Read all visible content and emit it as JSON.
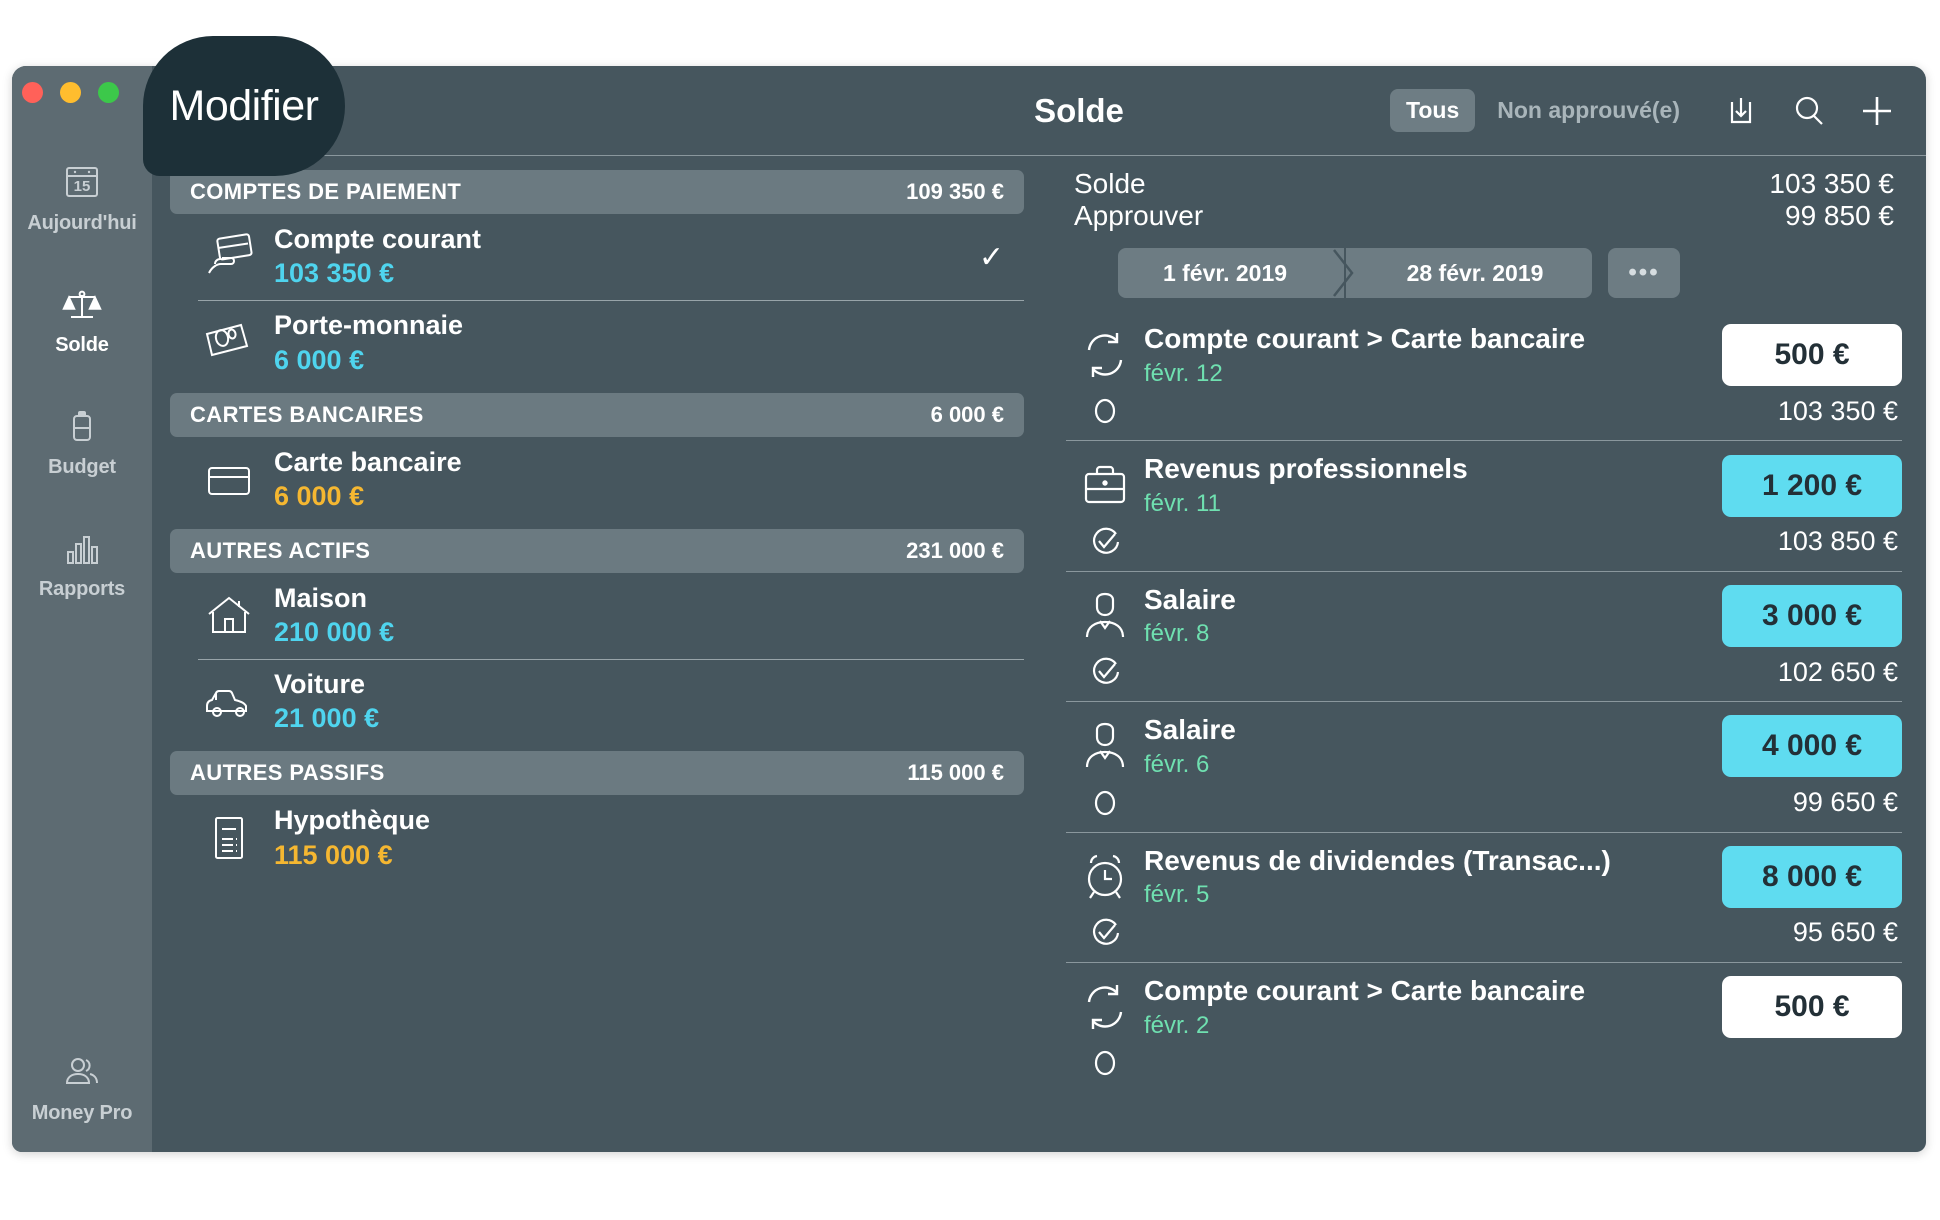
{
  "window": {
    "traffic_lights": [
      "close",
      "minimize",
      "maximize"
    ]
  },
  "overlay": {
    "tooltip_label": "Modifier"
  },
  "sidebar": {
    "items": [
      {
        "label": "Aujourd'hui",
        "icon": "calendar-15-icon",
        "active": false
      },
      {
        "label": "Solde",
        "icon": "scales-icon",
        "active": true
      },
      {
        "label": "Budget",
        "icon": "battery-icon",
        "active": false
      },
      {
        "label": "Rapports",
        "icon": "bar-chart-icon",
        "active": false
      }
    ],
    "bottom": {
      "label": "Money Pro",
      "icon": "users-icon"
    }
  },
  "toolbar": {
    "title": "Solde",
    "filters": [
      {
        "label": "Tous",
        "selected": true
      },
      {
        "label": "Non approuvé(e)",
        "selected": false
      }
    ],
    "actions": [
      {
        "name": "import-icon"
      },
      {
        "name": "search-icon"
      },
      {
        "name": "add-icon"
      }
    ]
  },
  "accounts": {
    "groups": [
      {
        "name": "COMPTES DE PAIEMENT",
        "total": "109 350 €",
        "rows": [
          {
            "name": "Compte courant",
            "amount": "103 350 €",
            "color": "blue",
            "icon": "hand-card-icon",
            "checked": true
          },
          {
            "name": "Porte-monnaie",
            "amount": "6 000 €",
            "color": "blue",
            "icon": "cash-icon",
            "checked": false
          }
        ]
      },
      {
        "name": "CARTES BANCAIRES",
        "total": "6 000 €",
        "rows": [
          {
            "name": "Carte bancaire",
            "amount": "6 000 €",
            "color": "amber",
            "icon": "credit-card-icon",
            "checked": false
          }
        ]
      },
      {
        "name": "AUTRES ACTIFS",
        "total": "231 000 €",
        "rows": [
          {
            "name": "Maison",
            "amount": "210 000 €",
            "color": "blue",
            "icon": "house-icon",
            "checked": false
          },
          {
            "name": "Voiture",
            "amount": "21 000 €",
            "color": "blue",
            "icon": "car-icon",
            "checked": false
          }
        ]
      },
      {
        "name": "AUTRES PASSIFS",
        "total": "115 000 €",
        "rows": [
          {
            "name": "Hypothèque",
            "amount": "115 000 €",
            "color": "amber",
            "icon": "document-icon",
            "checked": false
          }
        ]
      }
    ]
  },
  "details": {
    "summary": [
      {
        "label": "Solde",
        "value": "103 350 €"
      },
      {
        "label": "Approuver",
        "value": "99 850 €"
      }
    ],
    "date_range": {
      "start": "1 févr. 2019",
      "end": "28 févr. 2019",
      "more_label": "•••"
    },
    "transactions": [
      {
        "title": "Compte courant > Carte bancaire",
        "date": "févr. 12",
        "amount": "500 €",
        "amount_style": "white",
        "balance": "103 350 €",
        "icon": "transfer-icon",
        "approved": false
      },
      {
        "title": "Revenus professionnels",
        "date": "févr. 11",
        "amount": "1 200 €",
        "amount_style": "cyan",
        "balance": "103 850 €",
        "icon": "briefcase-icon",
        "approved": true
      },
      {
        "title": "Salaire",
        "date": "févr. 8",
        "amount": "3 000 €",
        "amount_style": "cyan",
        "balance": "102 650 €",
        "icon": "person-icon",
        "approved": true
      },
      {
        "title": "Salaire",
        "date": "févr. 6",
        "amount": "4 000 €",
        "amount_style": "cyan",
        "balance": "99 650 €",
        "icon": "person-icon",
        "approved": false
      },
      {
        "title": "Revenus de dividendes (Transac...)",
        "date": "févr. 5",
        "amount": "8 000 €",
        "amount_style": "cyan",
        "balance": "95 650 €",
        "icon": "alarm-clock-icon",
        "approved": true
      },
      {
        "title": "Compte courant > Carte bancaire",
        "date": "févr. 2",
        "amount": "500 €",
        "amount_style": "white",
        "balance": "",
        "icon": "transfer-icon",
        "approved": false
      }
    ]
  },
  "colors": {
    "window_bg": "#46565e",
    "sidebar_bg": "#5d6b72",
    "group_header_bg": "#6b7a81",
    "accent_blue": "#4fd4ee",
    "accent_amber": "#f5b731",
    "accent_green": "#6fe0b0",
    "badge_cyan": "#5fdcf0",
    "tooltip_bg": "#1d3038"
  }
}
